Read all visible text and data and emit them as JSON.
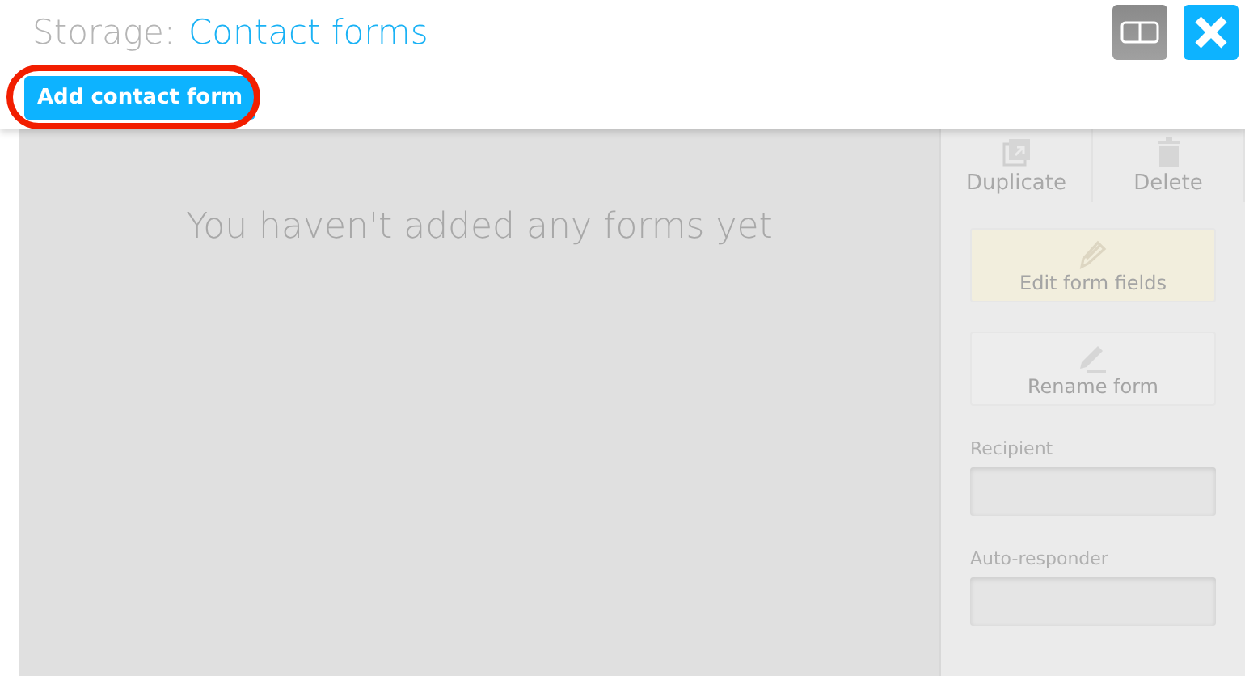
{
  "header": {
    "title_prefix": "Storage:",
    "title": "Contact forms",
    "add_button": "Add contact form",
    "highlighted": true
  },
  "empty_message": "You haven't added any forms yet",
  "toolbar": [
    {
      "kind": "duplicate",
      "label": "Duplicate",
      "disabled": true
    },
    {
      "kind": "delete",
      "label": "Delete",
      "disabled": true
    }
  ],
  "actions": [
    {
      "kind": "edit",
      "label": "Edit form fields",
      "disabled": true
    },
    {
      "kind": "rename",
      "label": "Rename form",
      "disabled": true
    }
  ],
  "fields": [
    {
      "label": "Recipient",
      "disabled": true
    },
    {
      "label": "Auto-responder",
      "disabled": true
    }
  ]
}
